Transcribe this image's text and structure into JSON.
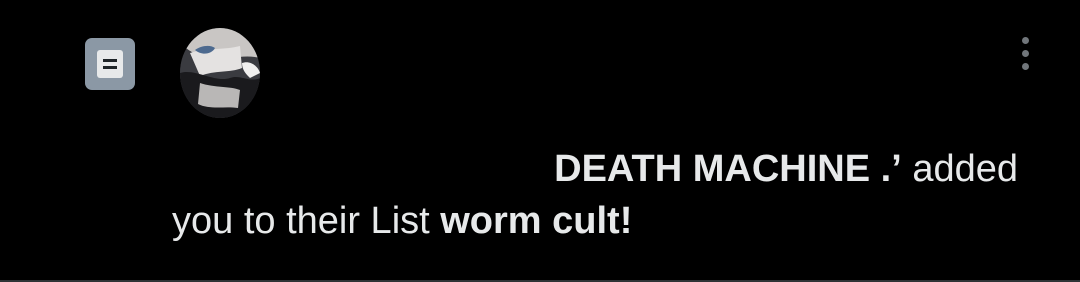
{
  "notification": {
    "actor_name": "DEATH MACHINE .’",
    "action_text_part1": " added",
    "action_text_part2": "you to their List ",
    "list_name": "worm cult!",
    "icons": {
      "type_icon": "list-icon",
      "menu_icon": "more-options-icon",
      "avatar": "user-avatar"
    },
    "colors": {
      "background": "#000000",
      "text": "#e7e9ea",
      "icon_bg": "#8b98a5",
      "muted": "#71767b"
    }
  }
}
